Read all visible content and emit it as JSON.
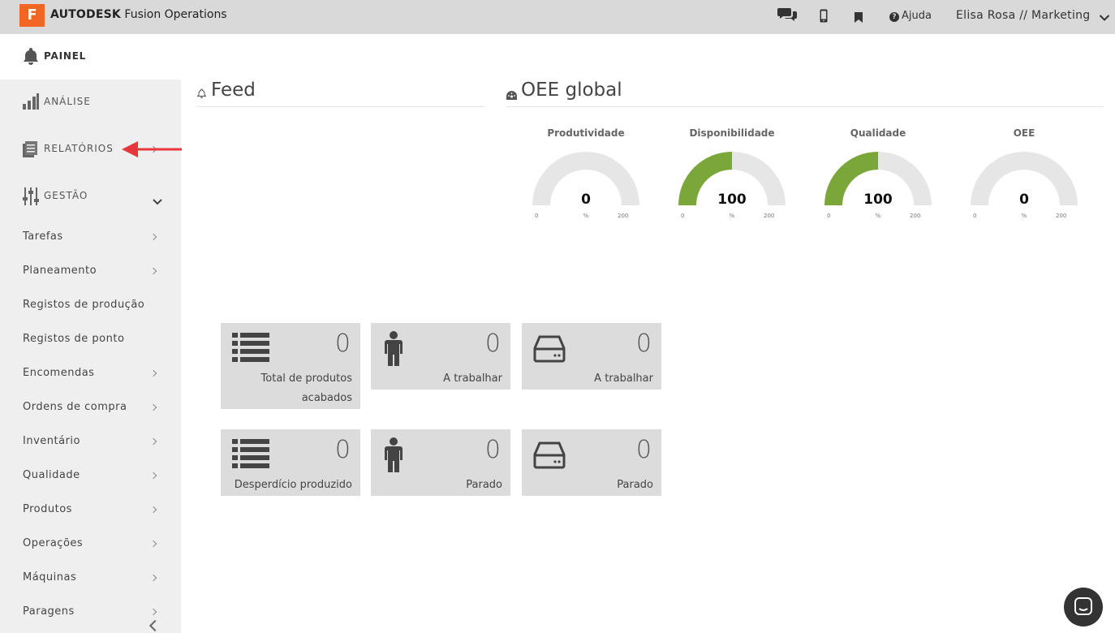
{
  "topbar": {
    "logo_letter": "F",
    "brand_bold": "AUTODESK",
    "brand_rest": "Fusion Operations",
    "help_label": "Ajuda",
    "user_label": "Elisa Rosa // Marketing"
  },
  "sidebar": {
    "painel_label": "PAINEL",
    "sections": {
      "analise": "ANÁLISE",
      "relatorios": "RELATÓRIOS",
      "gestao": "GESTÃO"
    },
    "items": [
      {
        "label": "Tarefas",
        "has_chevron": true
      },
      {
        "label": "Planeamento",
        "has_chevron": true
      },
      {
        "label": "Registos de produção",
        "has_chevron": false
      },
      {
        "label": "Registos de ponto",
        "has_chevron": false
      },
      {
        "label": "Encomendas",
        "has_chevron": true
      },
      {
        "label": "Ordens de compra",
        "has_chevron": true
      },
      {
        "label": "Inventário",
        "has_chevron": true
      },
      {
        "label": "Qualidade",
        "has_chevron": true
      },
      {
        "label": "Produtos",
        "has_chevron": true
      },
      {
        "label": "Operações",
        "has_chevron": true
      },
      {
        "label": "Máquinas",
        "has_chevron": true
      },
      {
        "label": "Paragens",
        "has_chevron": true
      }
    ]
  },
  "feed": {
    "title": "Feed"
  },
  "oee": {
    "title": "OEE global",
    "gauges": [
      {
        "label": "Produtividade",
        "value": 0,
        "min": "0",
        "max": "200",
        "unit": "%"
      },
      {
        "label": "Disponibilidade",
        "value": 100,
        "min": "0",
        "max": "200",
        "unit": "%"
      },
      {
        "label": "Qualidade",
        "value": 100,
        "min": "0",
        "max": "200",
        "unit": "%"
      },
      {
        "label": "OEE",
        "value": 0,
        "min": "0",
        "max": "200",
        "unit": "%"
      }
    ],
    "gauge_fill_color": "#7ba63a",
    "gauge_track_color": "#e6e6e6"
  },
  "cards": [
    {
      "icon": "list-icon",
      "value": "0",
      "label": "Total de produtos acabados"
    },
    {
      "icon": "person-icon",
      "value": "0",
      "label": "A trabalhar"
    },
    {
      "icon": "machine-icon",
      "value": "0",
      "label": "A trabalhar"
    },
    {
      "icon": "list-icon",
      "value": "0",
      "label": "Desperdício produzido"
    },
    {
      "icon": "person-icon",
      "value": "0",
      "label": "Parado"
    },
    {
      "icon": "machine-icon",
      "value": "0",
      "label": "Parado"
    }
  ],
  "colors": {
    "brand": "#f26522",
    "annotation_arrow": "#e8373c"
  }
}
